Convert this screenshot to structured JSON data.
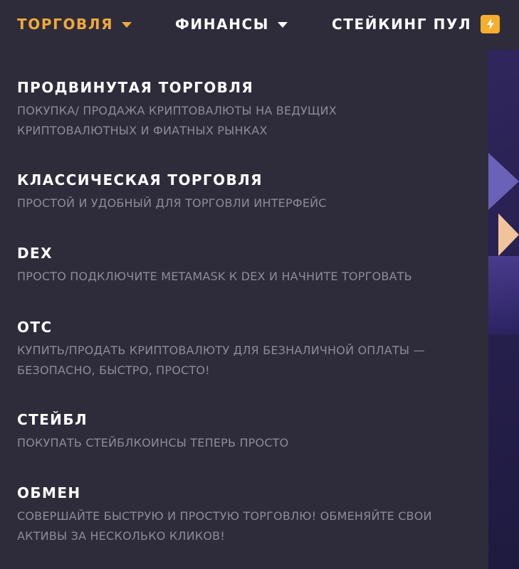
{
  "nav": {
    "trade_label": "ТОРГОВЛЯ",
    "finance_label": "ФИНАНСЫ",
    "staking_label": "СТЕЙКИНГ ПУЛ"
  },
  "colors": {
    "background": "#2e2c3a",
    "accent": "#f0a93a",
    "badge": "#f6ae2d",
    "title": "#ffffff",
    "description": "#8d8a9c"
  },
  "icons": {
    "trade_caret": "caret-down-icon",
    "finance_caret": "caret-down-icon",
    "staking_badge": "lightning-bolt-icon"
  },
  "dropdown": {
    "items": [
      {
        "title": "ПРОДВИНУТАЯ ТОРГОВЛЯ",
        "description": "ПОКУПКА/ ПРОДАЖА КРИПТОВАЛЮТЫ НА ВЕДУЩИХ КРИПТОВАЛЮТНЫХ И ФИАТНЫХ РЫНКАХ"
      },
      {
        "title": "КЛАССИЧЕСКАЯ ТОРГОВЛЯ",
        "description": "ПРОСТОЙ И УДОБНЫЙ ДЛЯ ТОРГОВЛИ ИНТЕРФЕЙС"
      },
      {
        "title": "DEX",
        "description": "ПРОСТО ПОДКЛЮЧИТЕ METAMASK К DEX И НАЧНИТЕ ТОРГОВАТЬ"
      },
      {
        "title": "OTC",
        "description": "КУПИТЬ/ПРОДАТЬ КРИПТОВАЛЮТУ ДЛЯ БЕЗНАЛИЧНОЙ ОПЛАТЫ — БЕЗОПАСНО, БЫСТРО, ПРОСТО!"
      },
      {
        "title": "СТЕЙБЛ",
        "description": "ПОКУПАТЬ СТЕЙБЛКОИНСЫ ТЕПЕРЬ ПРОСТО"
      },
      {
        "title": "ОБМЕН",
        "description": "СОВЕРШАЙТЕ БЫСТРУЮ И ПРОСТУЮ ТОРГОВЛЮ! ОБМЕНЯЙТЕ СВОИ АКТИВЫ ЗА НЕСКОЛЬКО КЛИКОВ!"
      }
    ]
  }
}
